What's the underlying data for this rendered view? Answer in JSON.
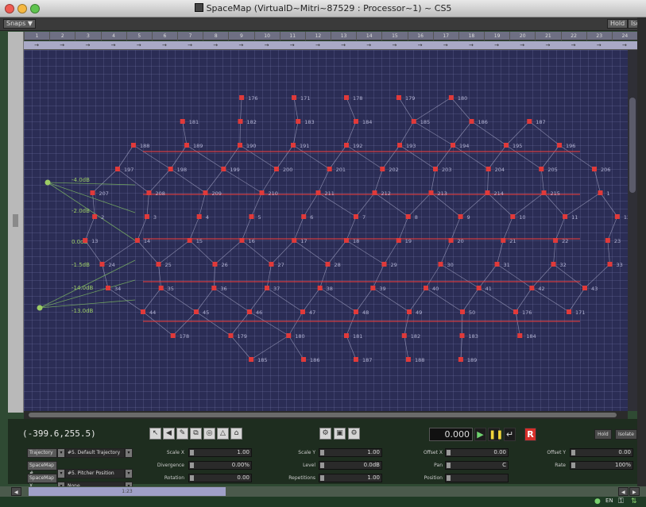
{
  "window": {
    "title": "SpaceMap (VirtualD~Mitri~87529 : Processor~1) ~ CS5"
  },
  "toolbar": {
    "left_button": "Snaps ▼",
    "right_buttons": [
      "Hold",
      "Isolate"
    ]
  },
  "ruler": {
    "channels": [
      "1",
      "2",
      "3",
      "4",
      "5",
      "6",
      "7",
      "8",
      "9",
      "10",
      "11",
      "12",
      "13",
      "14",
      "15",
      "16",
      "17",
      "18",
      "19",
      "20",
      "21",
      "22",
      "23",
      "24"
    ],
    "arrow": "→"
  },
  "canvas": {
    "grid_color": "#2b2d55",
    "node_color": "#e03a3a",
    "speaker_color": "#9ccc65",
    "node_labels": [
      "176",
      "171",
      "178",
      "179",
      "180",
      "181",
      "182",
      "183",
      "184",
      "185",
      "186",
      "187",
      "188",
      "189",
      "190",
      "191",
      "192",
      "193",
      "194",
      "195",
      "196",
      "197",
      "198",
      "199",
      "200",
      "201",
      "202",
      "203",
      "204",
      "205",
      "206",
      "207",
      "208",
      "209",
      "210",
      "211",
      "212",
      "213",
      "214",
      "215",
      "1",
      "2",
      "3",
      "4",
      "5",
      "6",
      "7",
      "8",
      "9",
      "10",
      "11",
      "12",
      "13",
      "14",
      "15",
      "16",
      "17",
      "18",
      "19",
      "20",
      "21",
      "22",
      "23",
      "24",
      "25",
      "26",
      "27",
      "28",
      "29",
      "30",
      "31",
      "32",
      "33",
      "34",
      "35",
      "36",
      "37",
      "38",
      "39",
      "40",
      "41",
      "42",
      "43",
      "44",
      "45",
      "46",
      "47",
      "48",
      "49",
      "50"
    ],
    "speaker_labels": [
      "-4.0dB",
      "-2.0dB",
      "0.0dB",
      "-1.5dB",
      "-14.0dB",
      "-13.0dB"
    ]
  },
  "status": {
    "coordinates": "(-399.6,255.5)"
  },
  "transport": {
    "time": "0.000",
    "hold": "Hold",
    "isolate": "Isolate"
  },
  "selectors": [
    {
      "label": "Trajectory",
      "value": "#5. Default Trajectory"
    },
    {
      "label": "SpaceMap #",
      "value": "#5. Pitcher Position"
    },
    {
      "label": "SpaceMap X",
      "value": "None"
    }
  ],
  "params": {
    "col1": [
      {
        "label": "Scale X",
        "value": "1.00"
      },
      {
        "label": "Divergence",
        "value": "0.00%"
      },
      {
        "label": "Rotation",
        "value": "0.00"
      }
    ],
    "col2": [
      {
        "label": "Scale Y",
        "value": "1.00"
      },
      {
        "label": "Level",
        "value": "0.0dB"
      },
      {
        "label": "Repetitions",
        "value": "1.00"
      }
    ],
    "col3": [
      {
        "label": "Offset X",
        "value": "0.00"
      },
      {
        "label": "Pan",
        "value": "C"
      },
      {
        "label": "Position",
        "value": ""
      }
    ],
    "col4": [
      {
        "label": "Offset Y",
        "value": "0.00"
      },
      {
        "label": "Rate",
        "value": "100%"
      }
    ]
  },
  "bottom": {
    "strip_label": "1:23"
  }
}
